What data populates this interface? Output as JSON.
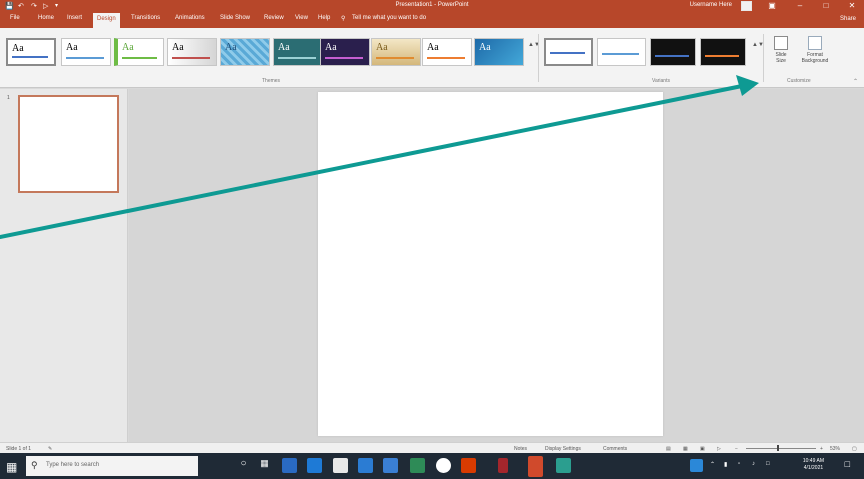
{
  "window": {
    "title": "Presentation1 - PowerPoint",
    "user": "Username Here"
  },
  "tabs": [
    "File",
    "Home",
    "Insert",
    "Design",
    "Transitions",
    "Animations",
    "Slide Show",
    "Review",
    "View",
    "Help"
  ],
  "active_tab": "Design",
  "tell_me": "Tell me what you want to do",
  "share": "Share",
  "ribbon": {
    "themes_label": "Themes",
    "variants_label": "Variants",
    "customize_label": "Customize",
    "theme_glyph": "Aa",
    "slide_size": "Slide Size",
    "format_background": "Format Background"
  },
  "slides_panel": {
    "slide_number": "1"
  },
  "status": {
    "slide_info": "Slide 1 of 1",
    "notes": "Notes",
    "display_settings": "Display Settings",
    "comments": "Comments",
    "zoom": "53%"
  },
  "taskbar": {
    "search_placeholder": "Type here to search",
    "time": "10:49 AM",
    "date": "4/1/2021"
  },
  "colors": {
    "accent": "#b7472a",
    "arrow": "#0e9a93"
  }
}
